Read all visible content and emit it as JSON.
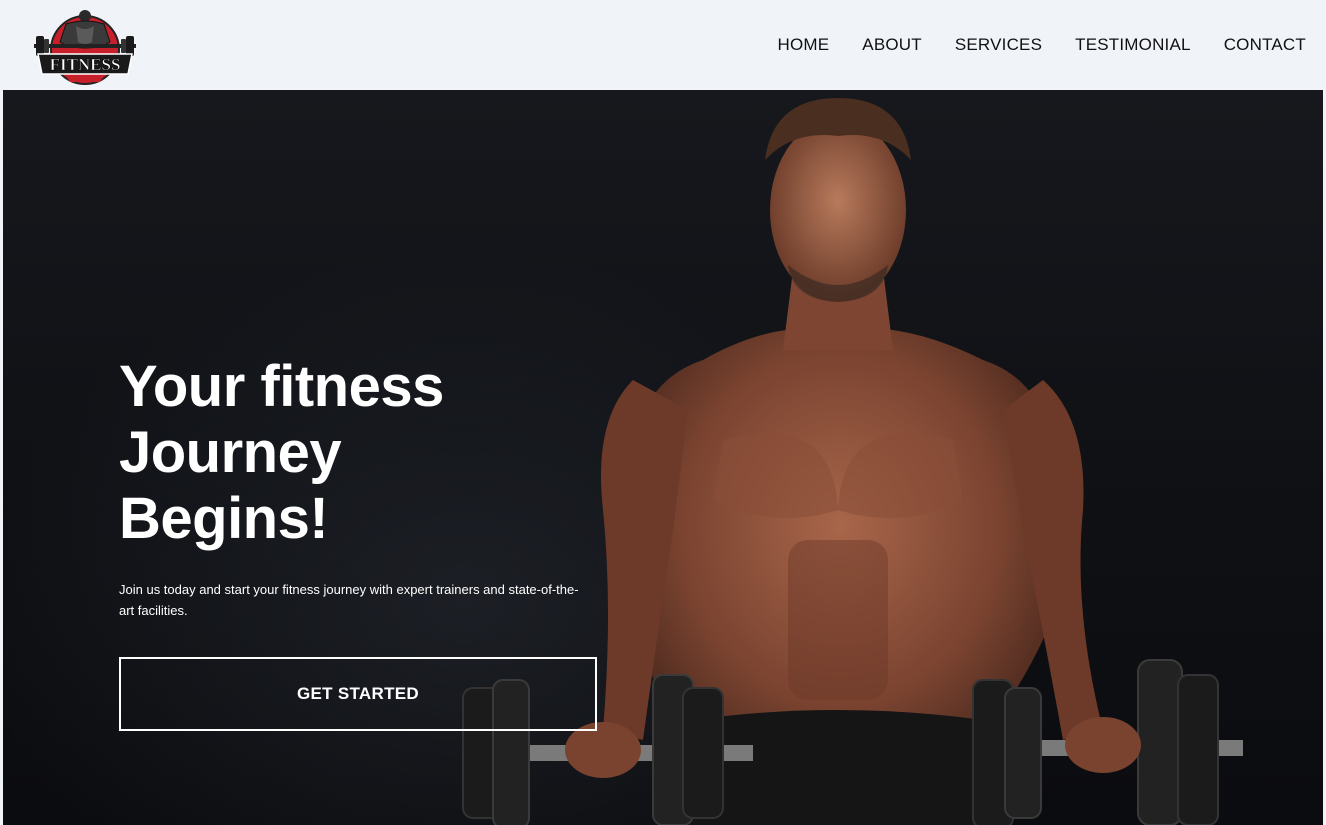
{
  "brand": {
    "logo_text": "FITNESS"
  },
  "nav": {
    "items": [
      {
        "label": "HOME"
      },
      {
        "label": "ABOUT"
      },
      {
        "label": "SERVICES"
      },
      {
        "label": "TESTIMONIAL"
      },
      {
        "label": "CONTACT"
      }
    ]
  },
  "hero": {
    "title": "Your fitness\nJourney\nBegins!",
    "subtitle": "Join us today and start your fitness journey with expert trainers and state-of-the-art facilities.",
    "cta_label": "GET STARTED"
  },
  "colors": {
    "header_bg": "#f0f4f9",
    "hero_bg": "#0f1115",
    "text_light": "#ffffff",
    "nav_text": "#111111",
    "logo_red": "#c8202a"
  }
}
